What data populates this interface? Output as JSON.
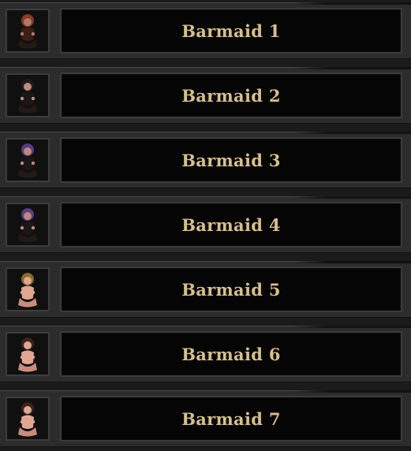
{
  "palette": {
    "label_color": "#d6c08a",
    "row_bg": "#2c2c2c",
    "name_bg": "#050505"
  },
  "characters": [
    {
      "name": "Barmaid 1",
      "icon": "barmaid-portrait-icon",
      "hair": "#8a3a22",
      "skin": "#b07a64",
      "outfit": "#3a1f16"
    },
    {
      "name": "Barmaid 2",
      "icon": "barmaid-portrait-icon",
      "hair": "#1e1a1a",
      "skin": "#c48a7a",
      "outfit": "#1c1616"
    },
    {
      "name": "Barmaid 3",
      "icon": "barmaid-portrait-icon",
      "hair": "#5a3a8a",
      "skin": "#c08878",
      "outfit": "#1c1616"
    },
    {
      "name": "Barmaid 4",
      "icon": "barmaid-portrait-icon",
      "hair": "#5a3a8a",
      "skin": "#c08878",
      "outfit": "#1c1616"
    },
    {
      "name": "Barmaid 5",
      "icon": "barmaid-portrait-icon",
      "hair": "#8a6a2a",
      "skin": "#e0a692",
      "outfit": "#e0a692"
    },
    {
      "name": "Barmaid 6",
      "icon": "barmaid-portrait-icon",
      "hair": "#3a2418",
      "skin": "#e0a692",
      "outfit": "#e0a692"
    },
    {
      "name": "Barmaid 7",
      "icon": "barmaid-portrait-icon",
      "hair": "#3a2418",
      "skin": "#e0a692",
      "outfit": "#e0a692"
    }
  ]
}
